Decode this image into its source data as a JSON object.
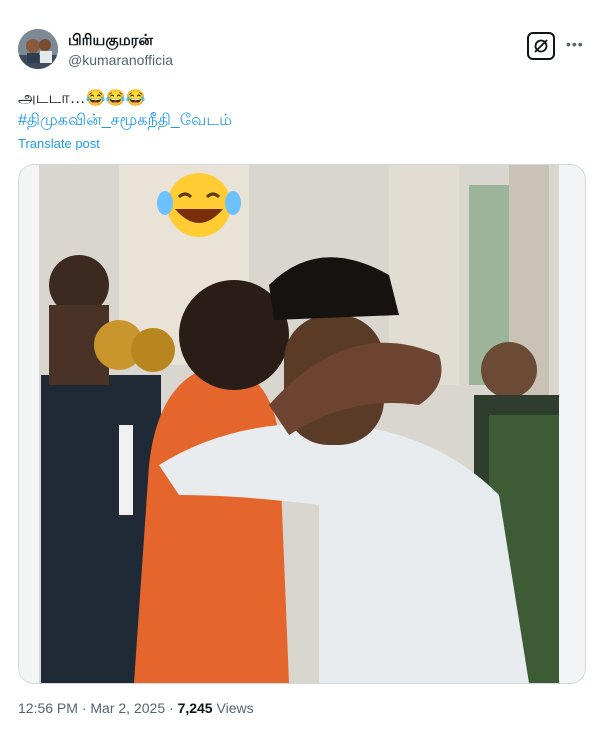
{
  "post": {
    "display_name": "பிரியகுமரன்",
    "handle": "@kumaranofficia",
    "text": "அடடா…😂😂😂",
    "hashtag": "#திமுகவின்_சமூகநீதி_வேடம்",
    "translate_label": "Translate post",
    "media_overlay_emoji": "😂"
  },
  "meta": {
    "time": "12:56 PM",
    "sep1": " · ",
    "date": "Mar 2, 2025",
    "sep2": " · ",
    "views_count": "7,245",
    "views_label": " Views"
  },
  "icons": {
    "grok": "grok-icon",
    "more": "more-icon"
  },
  "colors": {
    "link": "#1d9bf0",
    "secondary_text": "#536471",
    "border": "#cfd9de"
  }
}
